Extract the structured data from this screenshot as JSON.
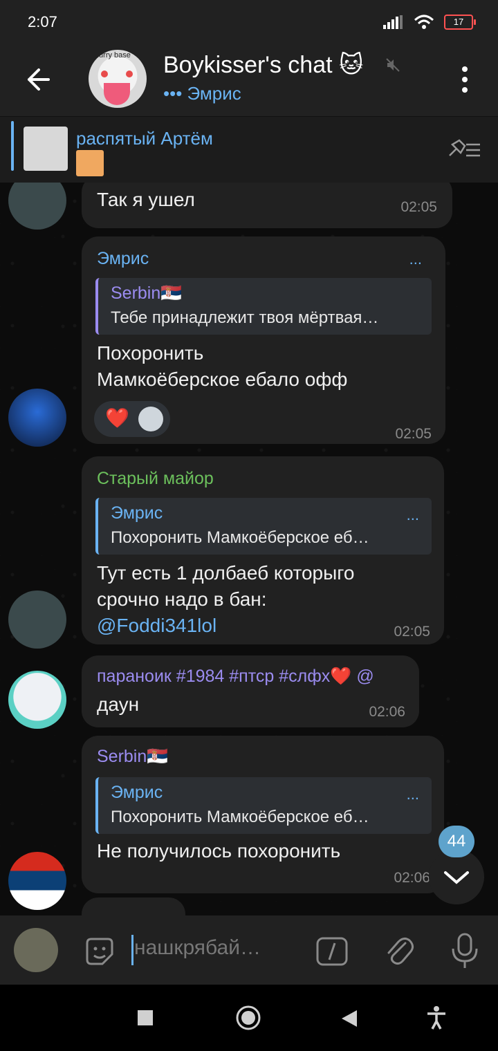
{
  "status_bar": {
    "time": "2:07",
    "battery": "17"
  },
  "header": {
    "title": "Boykisser's chat 🐱",
    "status": "••• Эмрис",
    "avatar_text": "furry base"
  },
  "pinned": {
    "name": "распятый Артём"
  },
  "messages": [
    {
      "id": "m1",
      "text": "Так я ушел",
      "time": "02:05"
    },
    {
      "id": "m2",
      "sender": "Эмрис",
      "more": "...",
      "reply_name": "Serbin🇷🇸",
      "reply_text": "Тебе принадлежит твоя мёртвая…",
      "line1": "Похоронить",
      "line2": "Мамкоёберское ебало офф",
      "reaction": "❤️",
      "time": "02:05"
    },
    {
      "id": "m3",
      "sender": "Старый майор",
      "reply_name": "Эмрис",
      "reply_more": "...",
      "reply_text": "Похоронить  Мамкоёберское еб…",
      "line1": "Тут есть 1 долбаеб которыго",
      "line2": "срочно надо в бан:",
      "mention": "@Foddi341lol",
      "time": "02:05"
    },
    {
      "id": "m4",
      "sender": "параноик #1984 #птср #слфх❤️ @",
      "text": "даун",
      "time": "02:06"
    },
    {
      "id": "m5",
      "sender": "Serbin🇷🇸",
      "reply_name": "Эмрис",
      "reply_more": "...",
      "reply_text": "Похоронить  Мамкоёберское еб…",
      "text": "Не получилось похоронить",
      "time": "02:06"
    }
  ],
  "scroll_badge": "44",
  "composer": {
    "placeholder": "нашкрябай…"
  },
  "colors": {
    "accent": "#6ab3f3",
    "sender_emris": "#6ab3f3",
    "sender_major": "#6cc05c",
    "sender_paranoik": "#9b8cf0",
    "sender_serbin": "#9b8cf0"
  }
}
